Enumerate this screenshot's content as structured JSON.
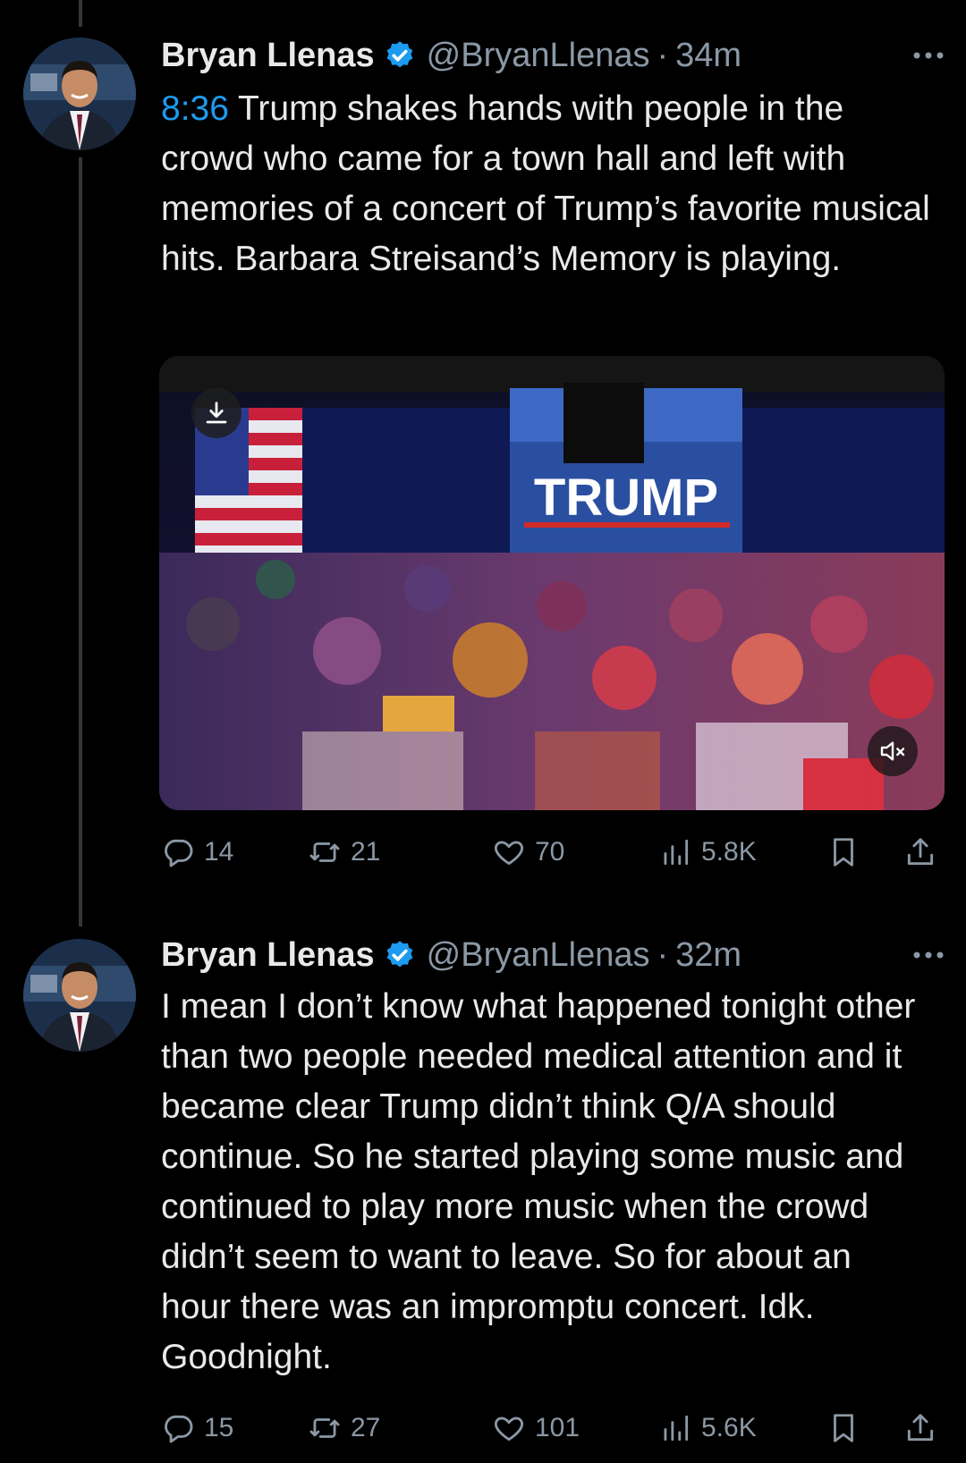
{
  "tweets": [
    {
      "name": "Bryan Llenas",
      "handle": "@BryanLlenas",
      "separator": "·",
      "time": "34m",
      "timestamp_link": "8:36",
      "body": " Trump shakes hands with people in the crowd who came for a town hall and left with memories of a concert of Trump’s favorite musical hits. Barbara Streisand’s Memory is playing.",
      "media": {
        "screen_text": "TRUMP"
      },
      "stats": {
        "replies": "14",
        "reposts": "21",
        "likes": "70",
        "views": "5.8K"
      }
    },
    {
      "name": "Bryan Llenas",
      "handle": "@BryanLlenas",
      "separator": "·",
      "time": "32m",
      "body": "I mean I don’t know what happened tonight other than two people needed medical attention and it became clear Trump didn’t think Q/A should continue. So he started playing some music and continued to play more music when the crowd didn’t seem to want to leave. So for about an hour there was an impromptu concert. Idk. Goodnight.",
      "stats": {
        "replies": "15",
        "reposts": "27",
        "likes": "101",
        "views": "5.6K"
      }
    }
  ],
  "icons": {
    "verified": "verified-badge-icon",
    "more": "more-options-icon",
    "reply": "reply-icon",
    "repost": "repost-icon",
    "like": "like-icon",
    "views": "views-icon",
    "bookmark": "bookmark-icon",
    "share": "share-icon",
    "download": "download-icon",
    "mute": "mute-icon"
  },
  "colors": {
    "accent": "#1d9bf0",
    "background": "#000000",
    "text": "#e7e9ea",
    "secondary": "#8b98a5"
  }
}
